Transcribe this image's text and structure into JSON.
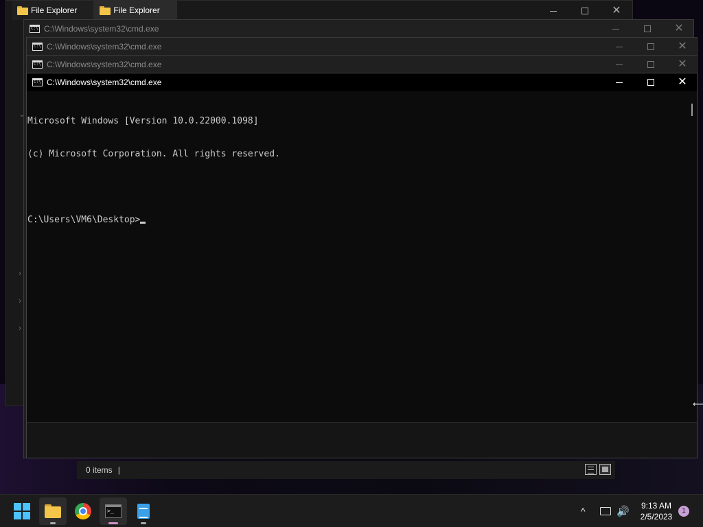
{
  "file_explorer": {
    "tabs": [
      {
        "label": "File Explorer"
      },
      {
        "label": "File Explorer"
      }
    ],
    "status": {
      "items_count": "0 items",
      "separator": "|"
    }
  },
  "cmd_windows": [
    {
      "title": "C:\\Windows\\system32\\cmd.exe"
    },
    {
      "title": "C:\\Windows\\system32\\cmd.exe"
    },
    {
      "title": "C:\\Windows\\system32\\cmd.exe"
    },
    {
      "title": "C:\\Windows\\system32\\cmd.exe"
    }
  ],
  "console": {
    "lines": [
      "Microsoft Windows [Version 10.0.22000.1098]",
      "(c) Microsoft Corporation. All rights reserved.",
      "",
      "C:\\Users\\VM6\\Desktop>"
    ]
  },
  "window_controls": {
    "minimize": "—",
    "maximize": "☐",
    "close": "✕"
  },
  "taskbar": {
    "apps": [
      {
        "name": "start",
        "icon": "windows-logo-icon"
      },
      {
        "name": "File Explorer",
        "icon": "folder-icon",
        "running": true
      },
      {
        "name": "Google Chrome",
        "icon": "chrome-icon",
        "running": false
      },
      {
        "name": "Command Prompt",
        "icon": "terminal-icon",
        "running": true,
        "focused": true
      },
      {
        "name": "Notepad",
        "icon": "notepad-icon",
        "running": true
      }
    ],
    "tray": {
      "chevron": "^",
      "volume": "🔊"
    },
    "clock": {
      "time": "9:13 AM",
      "date": "2/5/2023"
    },
    "notification_count": "1"
  },
  "colors": {
    "accent": "#4cc2ff",
    "console_text": "#cccccc",
    "console_bg": "#0c0c0c",
    "notification_badge": "#c8a0d8"
  }
}
